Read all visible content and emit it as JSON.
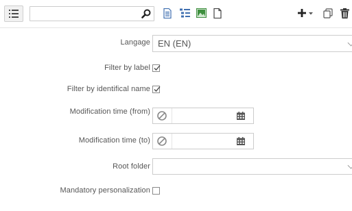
{
  "toolbar": {
    "search": {
      "value": "",
      "placeholder": ""
    },
    "icons": {
      "menu": "list-menu-icon",
      "search": "search-icon",
      "doc": "document-icon",
      "tree": "tree-list-icon",
      "image": "image-icon",
      "page": "page-icon",
      "add": "add-dropdown-icon",
      "copy": "copy-icon",
      "trash": "trash-icon"
    }
  },
  "form": {
    "language": {
      "label": "Langage",
      "value": "EN (EN)"
    },
    "filter_by_label": {
      "label": "Filter by label",
      "checked": true
    },
    "filter_by_identifical_name": {
      "label": "Filter by identifical name",
      "checked": true
    },
    "modification_time_from": {
      "label": "Modification time (from)",
      "value": ""
    },
    "modification_time_to": {
      "label": "Modification time (to)",
      "value": ""
    },
    "root_folder": {
      "label": "Root folder",
      "value": ""
    },
    "mandatory_personalization": {
      "label": "Mandatory personalization",
      "checked": false
    }
  },
  "colors": {
    "accent_blue": "#3f6fb0",
    "image_green": "#3d8f3d",
    "border": "#cccccc",
    "label_text": "#555555"
  }
}
